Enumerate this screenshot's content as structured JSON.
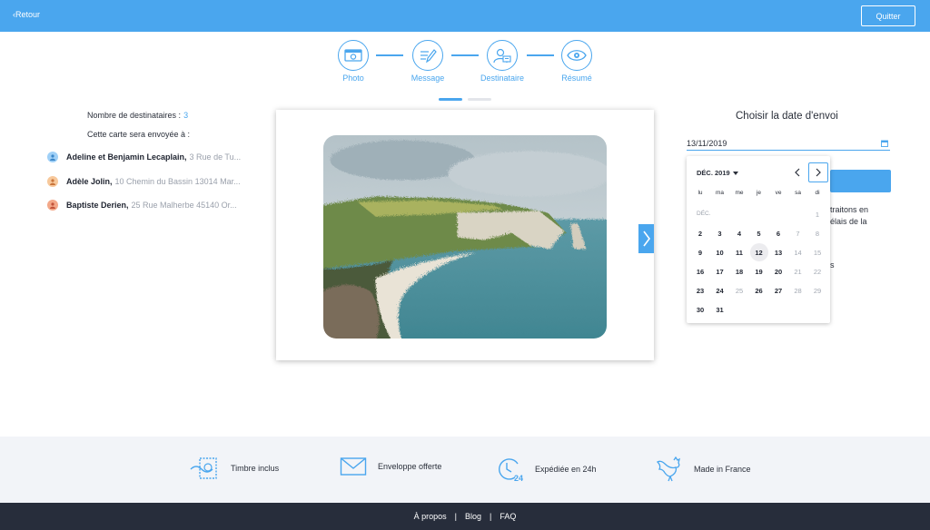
{
  "header": {
    "back_label": "Retour",
    "quit_label": "Quitter"
  },
  "steps": [
    {
      "label": "Photo",
      "icon": "photo-icon"
    },
    {
      "label": "Message",
      "icon": "message-pen-icon"
    },
    {
      "label": "Destinataire",
      "icon": "recipient-icon"
    },
    {
      "label": "Résumé",
      "icon": "eye-icon"
    }
  ],
  "recipients": {
    "count_label": "Nombre de destinataires :",
    "count_value": "3",
    "sent_to_label": "Cette carte sera envoyée à :",
    "list": [
      {
        "name": "Adeline et Benjamin Lecaplain,",
        "address": "3 Rue de Tu...",
        "avatar_color": "#9fd0f7"
      },
      {
        "name": "Adèle Jolin,",
        "address": "10 Chemin du Bassin 13014 Mar...",
        "avatar_color": "#f7c89b"
      },
      {
        "name": "Baptiste Derien,",
        "address": "25 Rue Malherbe 45140 Or...",
        "avatar_color": "#f3a889"
      }
    ]
  },
  "send_date": {
    "title": "Choisir la date d'envoi",
    "value": "13/11/2019",
    "hidden_text": [
      "traitons en",
      "élais de la",
      "s"
    ]
  },
  "calendar": {
    "month": "DÉC. 2019",
    "month_short": "DÉC.",
    "weekdays": [
      "lu",
      "ma",
      "me",
      "je",
      "ve",
      "sa",
      "di"
    ],
    "days": [
      {
        "day": "1",
        "enabled": false
      },
      {
        "day": "2",
        "enabled": true
      },
      {
        "day": "3",
        "enabled": true
      },
      {
        "day": "4",
        "enabled": true
      },
      {
        "day": "5",
        "enabled": true
      },
      {
        "day": "6",
        "enabled": true
      },
      {
        "day": "7",
        "enabled": false
      },
      {
        "day": "8",
        "enabled": false
      },
      {
        "day": "9",
        "enabled": true
      },
      {
        "day": "10",
        "enabled": true
      },
      {
        "day": "11",
        "enabled": true
      },
      {
        "day": "12",
        "enabled": true,
        "today": true
      },
      {
        "day": "13",
        "enabled": true
      },
      {
        "day": "14",
        "enabled": false
      },
      {
        "day": "15",
        "enabled": false
      },
      {
        "day": "16",
        "enabled": true
      },
      {
        "day": "17",
        "enabled": true
      },
      {
        "day": "18",
        "enabled": true
      },
      {
        "day": "19",
        "enabled": true
      },
      {
        "day": "20",
        "enabled": true
      },
      {
        "day": "21",
        "enabled": false
      },
      {
        "day": "22",
        "enabled": false
      },
      {
        "day": "23",
        "enabled": true
      },
      {
        "day": "24",
        "enabled": true
      },
      {
        "day": "25",
        "enabled": false
      },
      {
        "day": "26",
        "enabled": true
      },
      {
        "day": "27",
        "enabled": true
      },
      {
        "day": "28",
        "enabled": false
      },
      {
        "day": "29",
        "enabled": false
      },
      {
        "day": "30",
        "enabled": true
      },
      {
        "day": "31",
        "enabled": true
      }
    ]
  },
  "features": [
    {
      "label": "Timbre inclus",
      "icon": "stamp-icon"
    },
    {
      "label": "Enveloppe offerte",
      "icon": "envelope-icon"
    },
    {
      "label": "Expédiée en 24h",
      "icon": "clock-24h-icon"
    },
    {
      "label": "Made in France",
      "icon": "rooster-icon"
    }
  ],
  "footer": {
    "links": [
      "À propos",
      "Blog",
      "FAQ"
    ],
    "separator": "|"
  },
  "colors": {
    "accent": "#4aa6ee",
    "footer_bg": "#272d3b",
    "features_bg": "#f2f4f8"
  }
}
